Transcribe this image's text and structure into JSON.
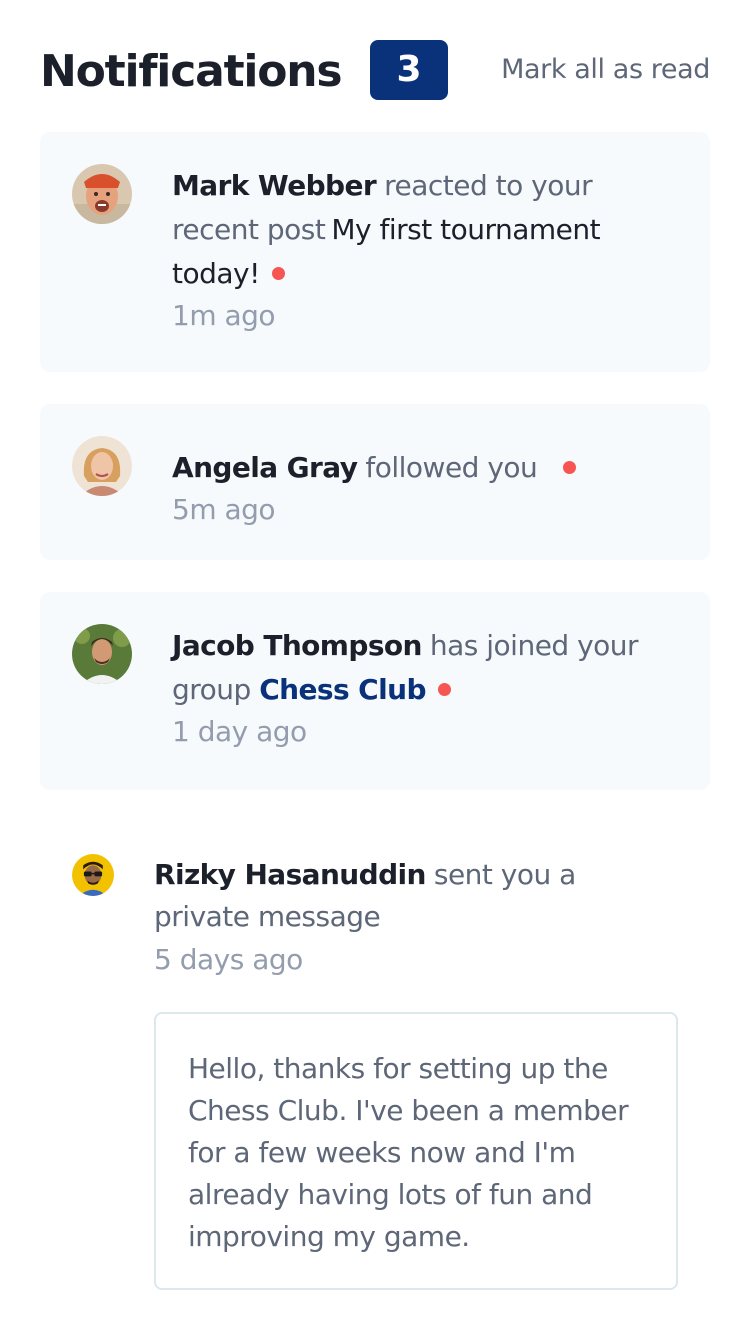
{
  "header": {
    "title": "Notifications",
    "count": "3",
    "mark_all": "Mark all as read"
  },
  "notifications": [
    {
      "name": "Mark Webber",
      "action": "reacted to your recent post",
      "target": "My first tournament today!",
      "time": "1m ago",
      "unread": true,
      "avatar": "avatar-mark-webber"
    },
    {
      "name": "Angela Gray",
      "action": "followed you",
      "time": "5m ago",
      "unread": true,
      "avatar": "avatar-angela-gray"
    },
    {
      "name": "Jacob Thompson",
      "action": "has joined your group",
      "target": "Chess Club",
      "time": "1 day ago",
      "unread": true,
      "avatar": "avatar-jacob-thompson"
    },
    {
      "name": "Rizky Hasanuddin",
      "action": "sent you a private message",
      "time": "5 days ago",
      "unread": false,
      "avatar": "avatar-rizky-hasanuddin",
      "message": "Hello, thanks for setting up the Chess Club. I've been a member for a few weeks now and I'm already having lots of fun and improving my game."
    }
  ],
  "colors": {
    "unread_bg": "#f7fafd",
    "badge": "#0a327b",
    "dot": "#f65552",
    "name": "#1c202b",
    "text": "#5e6778",
    "time": "#939dae"
  }
}
